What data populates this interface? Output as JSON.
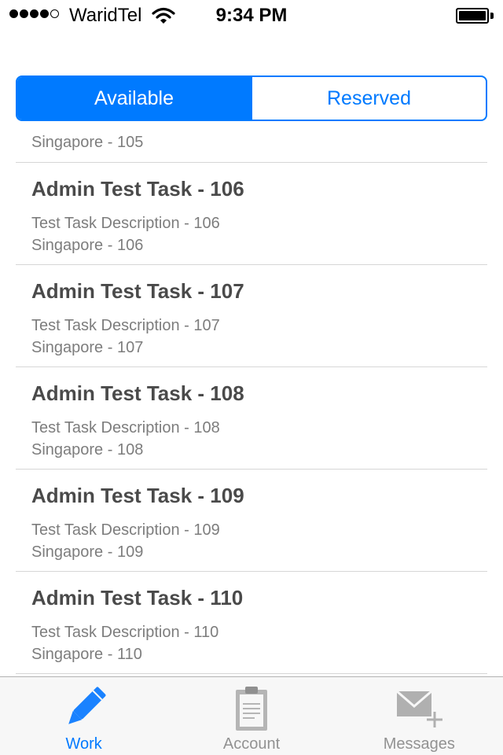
{
  "status_bar": {
    "carrier": "WaridTel",
    "time": "9:34 PM",
    "signal_bars": 4,
    "signal_max": 5,
    "battery_level": 1.0,
    "icons": [
      "wifi-icon",
      "battery-icon"
    ]
  },
  "segmented": {
    "segments": [
      {
        "label": "Available",
        "selected": true
      },
      {
        "label": "Reserved",
        "selected": false
      }
    ],
    "accent_color": "#007aff"
  },
  "task_list": {
    "partial_item": {
      "location": "Singapore - 105"
    },
    "items": [
      {
        "title": "Admin Test Task - 106",
        "description": "Test Task Description - 106",
        "location": "Singapore - 106"
      },
      {
        "title": "Admin Test Task - 107",
        "description": "Test Task Description - 107",
        "location": "Singapore - 107"
      },
      {
        "title": "Admin Test Task - 108",
        "description": "Test Task Description - 108",
        "location": "Singapore - 108"
      },
      {
        "title": "Admin Test Task - 109",
        "description": "Test Task Description - 109",
        "location": "Singapore - 109"
      },
      {
        "title": "Admin Test Task - 110",
        "description": "Test Task Description - 110",
        "location": "Singapore - 110"
      }
    ]
  },
  "tab_bar": {
    "tabs": [
      {
        "label": "Work",
        "icon": "pencil-icon",
        "selected": true
      },
      {
        "label": "Account",
        "icon": "clipboard-icon",
        "selected": false
      },
      {
        "label": "Messages",
        "icon": "envelope-add-icon",
        "selected": false
      }
    ]
  }
}
